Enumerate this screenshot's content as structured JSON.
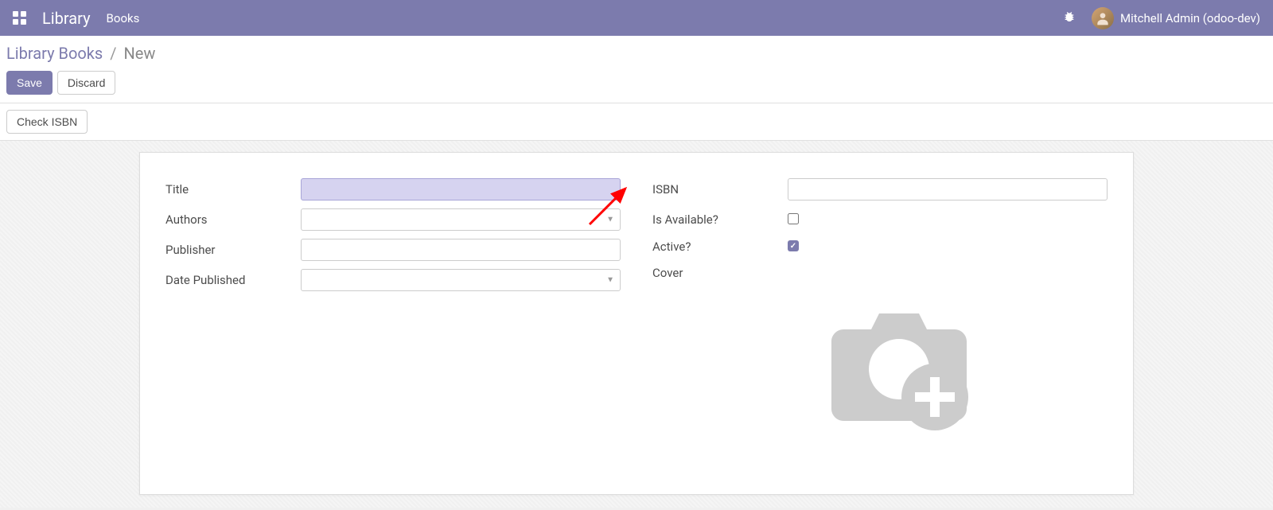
{
  "header": {
    "app_name": "Library",
    "menu_item": "Books",
    "user_name": "Mitchell Admin (odoo-dev)"
  },
  "breadcrumb": {
    "parent": "Library Books",
    "current": "New"
  },
  "buttons": {
    "save": "Save",
    "discard": "Discard",
    "check_isbn": "Check ISBN"
  },
  "form": {
    "left": {
      "title": {
        "label": "Title",
        "value": ""
      },
      "authors": {
        "label": "Authors",
        "value": ""
      },
      "publisher": {
        "label": "Publisher",
        "value": ""
      },
      "date_published": {
        "label": "Date Published",
        "value": ""
      }
    },
    "right": {
      "isbn": {
        "label": "ISBN",
        "value": ""
      },
      "is_available": {
        "label": "Is Available?",
        "checked": false
      },
      "active": {
        "label": "Active?",
        "checked": true
      },
      "cover": {
        "label": "Cover"
      }
    }
  }
}
